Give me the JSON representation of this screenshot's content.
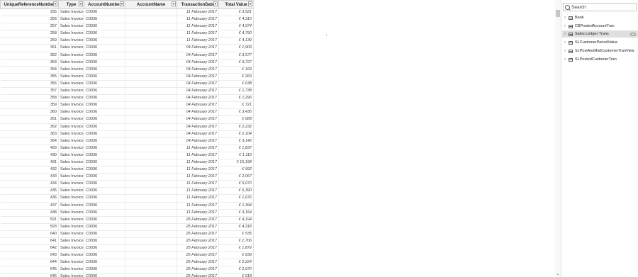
{
  "table": {
    "columns": [
      "UniqueReferenceNumber",
      "Type",
      "AccountNumber",
      "AccountName",
      "TransactionDate",
      "Total Value"
    ],
    "rows": [
      [
        "255",
        "Sales Invoice",
        "C0036",
        "11 February 2017",
        "€ 3,521"
      ],
      [
        "256",
        "Sales Invoice",
        "C0036",
        "11 February 2017",
        "€ 4,310"
      ],
      [
        "257",
        "Sales Invoice",
        "C0036",
        "11 February 2017",
        "€ 4,974"
      ],
      [
        "258",
        "Sales Invoice",
        "C0036",
        "11 February 2017",
        "€ 4,790"
      ],
      [
        "259",
        "Sales Invoice",
        "C0036",
        "11 February 2017",
        "€ 4,139"
      ],
      [
        "351",
        "Sales Invoice",
        "C0036",
        "04 February 2017",
        "€ 1,909"
      ],
      [
        "352",
        "Sales Invoice",
        "C0036",
        "04 February 2017",
        "€ 3,577"
      ],
      [
        "353",
        "Sales Invoice",
        "C0036",
        "04 February 2017",
        "€ 3,727"
      ],
      [
        "354",
        "Sales Invoice",
        "C0036",
        "04 February 2017",
        "€ 169"
      ],
      [
        "355",
        "Sales Invoice",
        "C0036",
        "04 February 2017",
        "€ 269"
      ],
      [
        "356",
        "Sales Invoice",
        "C0036",
        "04 February 2017",
        "€ 638"
      ],
      [
        "357",
        "Sales Invoice",
        "C0036",
        "04 February 2017",
        "€ 1,738"
      ],
      [
        "358",
        "Sales Invoice",
        "C0036",
        "04 February 2017",
        "€ 1,296"
      ],
      [
        "359",
        "Sales Invoice",
        "C0036",
        "04 February 2017",
        "€ 721"
      ],
      [
        "360",
        "Sales Invoice",
        "C0036",
        "04 February 2017",
        "€ 3,435"
      ],
      [
        "361",
        "Sales Invoice",
        "C0036",
        "04 February 2017",
        "€ 689"
      ],
      [
        "362",
        "Sales Invoice",
        "C0036",
        "04 February 2017",
        "€ 2,232"
      ],
      [
        "363",
        "Sales Invoice",
        "C0036",
        "04 February 2017",
        "€ 2,104"
      ],
      [
        "364",
        "Sales Invoice",
        "C0036",
        "04 February 2017",
        "€ 3,146"
      ],
      [
        "429",
        "Sales Invoice",
        "C0036",
        "11 February 2017",
        "€ 1,837"
      ],
      [
        "430",
        "Sales Invoice",
        "C0036",
        "11 February 2017",
        "€ 1,119"
      ],
      [
        "431",
        "Sales Invoice",
        "C0036",
        "11 February 2017",
        "€ 15,198"
      ],
      [
        "432",
        "Sales Invoice",
        "C0036",
        "11 February 2017",
        "€ 992"
      ],
      [
        "433",
        "Sales Invoice",
        "C0036",
        "11 February 2017",
        "€ 2,067"
      ],
      [
        "434",
        "Sales Invoice",
        "C0036",
        "11 February 2017",
        "€ 5,070"
      ],
      [
        "435",
        "Sales Invoice",
        "C0036",
        "11 February 2017",
        "€ 5,390"
      ],
      [
        "436",
        "Sales Invoice",
        "C0036",
        "11 February 2017",
        "€ 1,676"
      ],
      [
        "437",
        "Sales Invoice",
        "C0036",
        "11 February 2017",
        "€ 1,394"
      ],
      [
        "438",
        "Sales Invoice",
        "C0036",
        "11 February 2017",
        "€ 3,154"
      ],
      [
        "591",
        "Sales Invoice",
        "C0036",
        "25 February 2017",
        "€ 4,194"
      ],
      [
        "593",
        "Sales Invoice",
        "C0036",
        "25 February 2017",
        "€ 4,318"
      ],
      [
        "640",
        "Sales Invoice",
        "C0036",
        "25 February 2017",
        "€ 535"
      ],
      [
        "641",
        "Sales Invoice",
        "C0036",
        "25 February 2017",
        "€ 1,706"
      ],
      [
        "642",
        "Sales Invoice",
        "C0036",
        "25 February 2017",
        "€ 1,879"
      ],
      [
        "643",
        "Sales Invoice",
        "C0036",
        "25 February 2017",
        "€ 639"
      ],
      [
        "644",
        "Sales Invoice",
        "C0036",
        "25 February 2017",
        "€ 2,224"
      ],
      [
        "645",
        "Sales Invoice",
        "C0036",
        "25 February 2017",
        "€ 2,970"
      ],
      [
        "646",
        "Sales Invoice",
        "C0036",
        "25 February 2017",
        "€ 518"
      ]
    ]
  },
  "fields_pane": {
    "search_placeholder": "Search",
    "items": [
      {
        "label": "Bank",
        "selected": false
      },
      {
        "label": "CBPostedAccountTran",
        "selected": false
      },
      {
        "label": "Sales Ledger Trans",
        "selected": true
      },
      {
        "label": "SLCustomerPeriodValue",
        "selected": false
      },
      {
        "label": "SLPostAndHistCustomerTranView",
        "selected": false
      },
      {
        "label": "SLPostedCustomerTran",
        "selected": false
      }
    ]
  },
  "icons": {
    "column_dropdown": "chevron-down-icon",
    "search": "search-icon",
    "table": "table-icon",
    "expand": "chevron-right-icon",
    "visibility": "eye-icon"
  },
  "colors": {
    "header_bg": "#f3f2f1",
    "selected_item_bg": "#e1dfdd",
    "text": "#252423"
  }
}
